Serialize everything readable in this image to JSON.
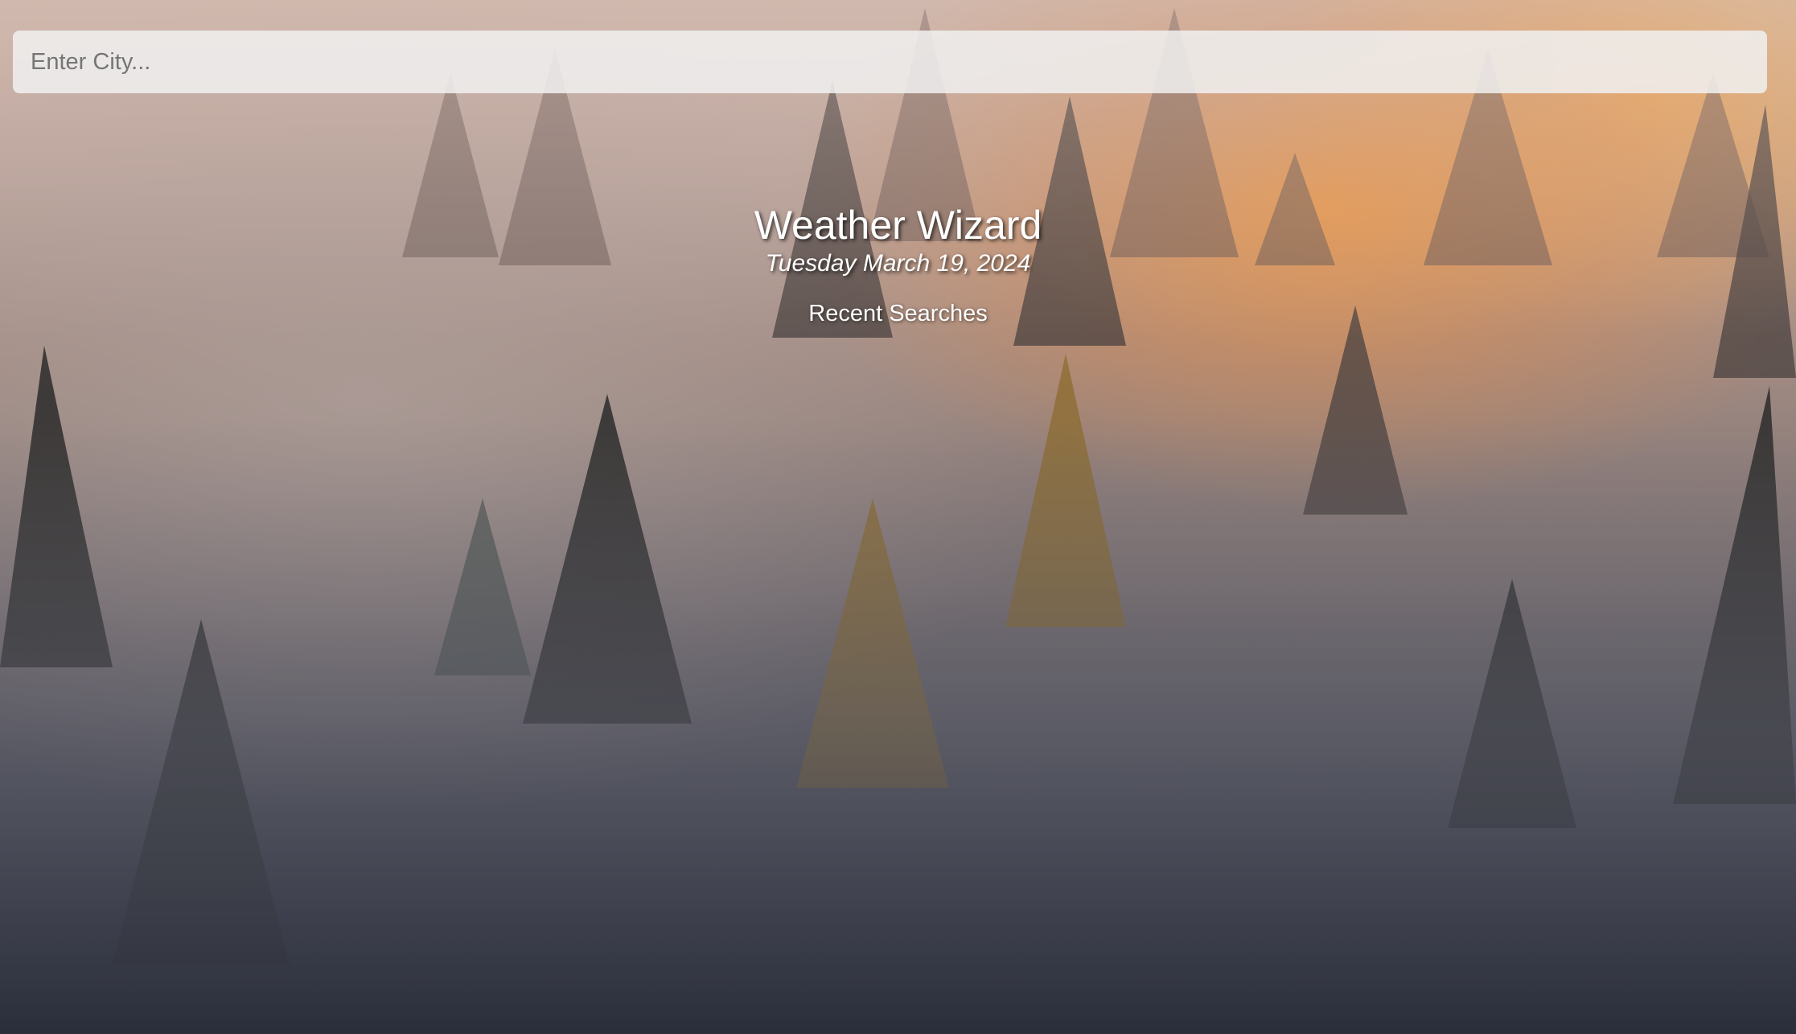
{
  "search": {
    "placeholder": "Enter City...",
    "value": ""
  },
  "header": {
    "title": "Weather Wizard",
    "date": "Tuesday March 19, 2024"
  },
  "recent": {
    "heading": "Recent Searches",
    "items": []
  },
  "background": {
    "subject": "misty-forest-photo",
    "accent": "#e8964a",
    "text_color": "#ffffff"
  }
}
